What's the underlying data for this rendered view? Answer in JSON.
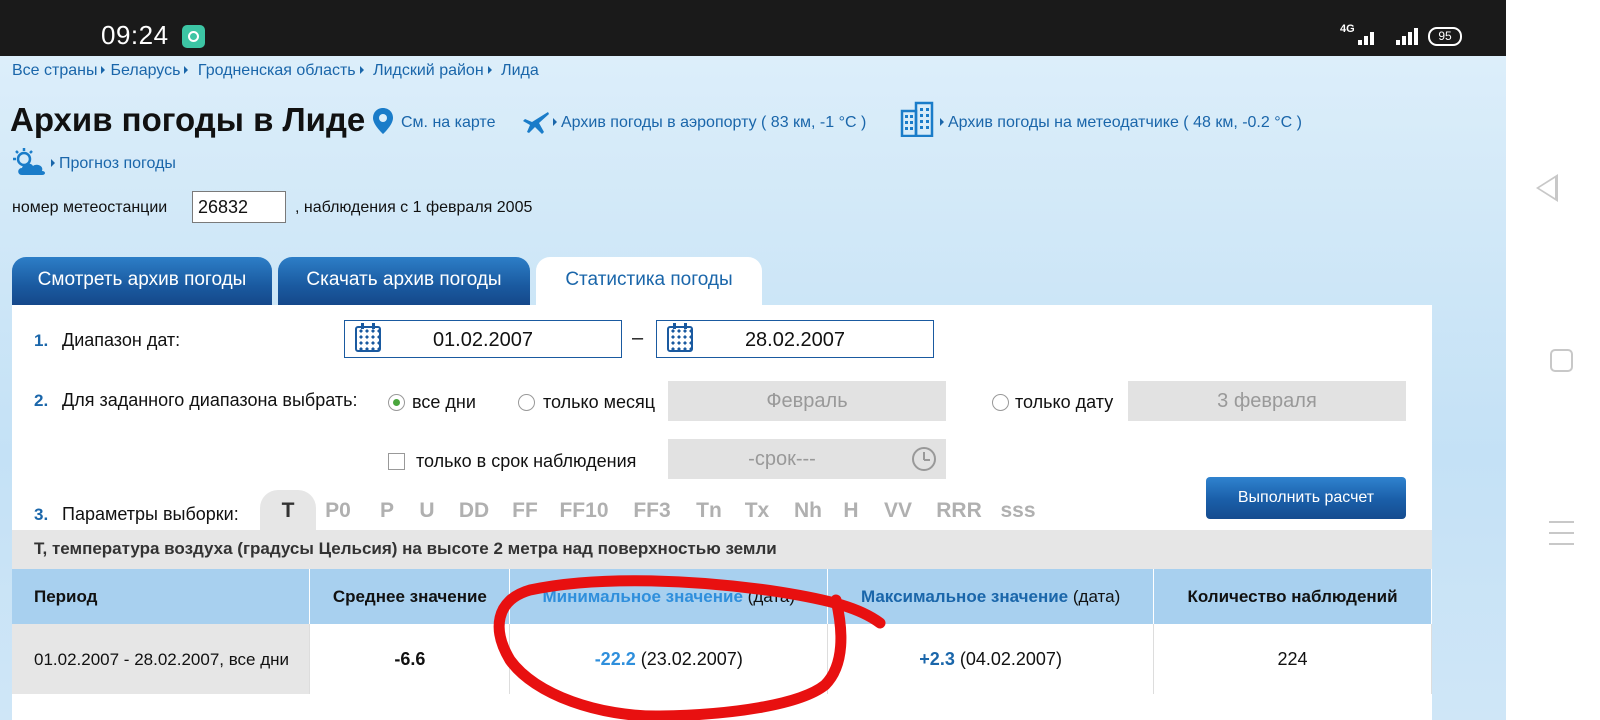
{
  "status_bar": {
    "time": "09:24",
    "network": "4G",
    "battery": "95"
  },
  "breadcrumb": [
    "Все страны",
    "Беларусь",
    "Гродненская область",
    "Лидский район",
    "Лида"
  ],
  "page_title": "Архив погоды в Лиде",
  "links": {
    "map": "См. на карте",
    "airport": "Архив погоды в аэропорту ( 83 км, -1 °C )",
    "sensor": "Архив погоды на метеодатчике ( 48 км, -0.2 °C )",
    "forecast": "Прогноз погоды"
  },
  "station": {
    "label": "номер метеостанции",
    "value": "26832",
    "suffix": ", наблюдения с 1 февраля 2005"
  },
  "tabs": [
    "Смотреть архив погоды",
    "Скачать архив погоды",
    "Статистика погоды"
  ],
  "form": {
    "step1": {
      "num": "1.",
      "label": "Диапазон дат:",
      "date_from": "01.02.2007",
      "date_to": "28.02.2007",
      "dash": "–"
    },
    "step2": {
      "num": "2.",
      "label": "Для заданного диапазона выбрать:",
      "opt_all": "все дни",
      "opt_month": "только месяц",
      "month_value": "Февраль",
      "opt_date": "только дату",
      "date_value": "3 февраля",
      "opt_time": "только в срок наблюдения",
      "time_value": "-срок---"
    },
    "step3": {
      "num": "3.",
      "label": "Параметры выборки:"
    },
    "params": [
      "T",
      "P0",
      "P",
      "U",
      "DD",
      "FF",
      "FF10",
      "FF3",
      "Tn",
      "Tx",
      "Nh",
      "H",
      "VV",
      "RRR",
      "sss"
    ],
    "submit": "Выполнить расчет"
  },
  "description": "T, температура воздуха (градусы Цельсия) на высоте 2 метра над поверхностью земли",
  "table": {
    "headers": {
      "period": "Период",
      "avg": "Среднее значение",
      "min": "Минимальное значение",
      "min_suffix": "(дата)",
      "max": "Максимальное значение",
      "max_suffix": "(дата)",
      "count": "Количество наблюдений"
    },
    "row": {
      "period": "01.02.2007 - 28.02.2007, все дни",
      "avg": "-6.6",
      "min_value": "-22.2",
      "min_date": "(23.02.2007)",
      "max_value": "+2.3",
      "max_date": "(04.02.2007)",
      "count": "224"
    }
  },
  "colors": {
    "link": "#1a66aa",
    "tab_dark": "#1a5aa0",
    "header_bg": "#a8d0ef",
    "annotation": "#e81010"
  }
}
